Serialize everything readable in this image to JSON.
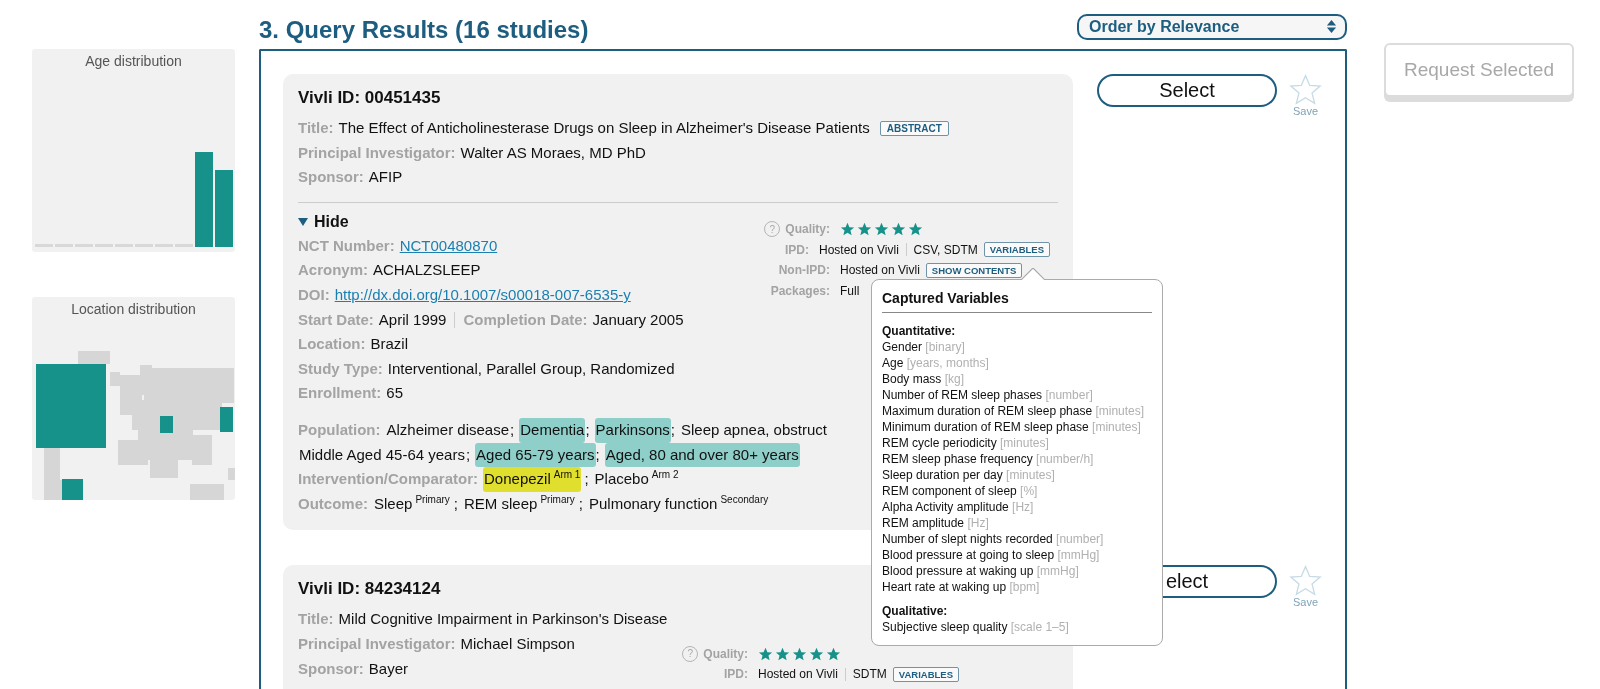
{
  "sidebar": {
    "panels": [
      {
        "kind": "age",
        "title": "Age distribution"
      },
      {
        "kind": "location",
        "title": "Location distribution"
      }
    ]
  },
  "header": {
    "title": "3. Query Results (16 studies)",
    "order": {
      "value": "Order by Relevance"
    }
  },
  "request_button": {
    "label": "Request Selected",
    "disabled": true
  },
  "cards": [
    {
      "heading": "Vivli ID: 00451435",
      "fields": [
        {
          "pairs": [
            {
              "label": "Title:",
              "value": "The Effect of Anticholinesterase Drugs on Sleep in Alzheimer's Disease Patients",
              "link": false
            }
          ],
          "button": "ABSTRACT"
        },
        {
          "pairs": [
            {
              "label": "Principal Investigator:",
              "value": "Walter AS Moraes, MD PhD",
              "link": false
            }
          ]
        },
        {
          "pairs": [
            {
              "label": "Sponsor:",
              "value": "AFIP",
              "link": false
            }
          ]
        }
      ],
      "expanded": true,
      "toggle_label": "Hide",
      "details": [
        {
          "pairs": [
            {
              "label": "NCT Number:",
              "value": "NCT00480870",
              "link": true
            }
          ]
        },
        {
          "pairs": [
            {
              "label": "Acronym:",
              "value": "ACHALZSLEEP",
              "link": false
            }
          ]
        },
        {
          "pairs": [
            {
              "label": "DOI:",
              "value": "http://dx.doi.org/10.1007/s00018-007-6535-y",
              "link": true
            }
          ]
        },
        {
          "pairs": [
            {
              "label": "Start Date:",
              "value": "April 1999",
              "link": false
            },
            {
              "label": "Completion Date:",
              "value": "January 2005",
              "link": false
            }
          ]
        },
        {
          "pairs": [
            {
              "label": "Location:",
              "value": "Brazil",
              "link": false
            }
          ]
        },
        {
          "pairs": [
            {
              "label": "Study Type:",
              "value": "Interventional, Parallel Group, Randomized",
              "link": false
            }
          ]
        },
        {
          "pairs": [
            {
              "label": "Enrollment:",
              "value": "65",
              "link": false
            }
          ]
        }
      ],
      "terms": [
        {
          "kind": "population",
          "label": "Population:",
          "lines": [
            [
              {
                "text": "Alzheimer disease",
                "sep": ";",
                "highlighted": false
              },
              {
                "text": "Dementia",
                "sep": ";",
                "highlighted": true
              },
              {
                "text": "Parkinsons",
                "sep": ";",
                "highlighted": true
              },
              {
                "text": "Sleep apnea, obstruct",
                "highlighted": false
              }
            ],
            [
              {
                "text": "Middle Aged 45-64 years",
                "sep": ";",
                "highlighted": false
              },
              {
                "text": "Aged 65-79 years",
                "sep": ";",
                "highlighted": true
              },
              {
                "text": "Aged, 80 and over 80+ years",
                "highlighted": true
              }
            ]
          ]
        },
        {
          "kind": "intervention",
          "label": "Intervention/Comparator:",
          "lines": [
            [
              {
                "text": "Donepezil",
                "sup": "Arm 1",
                "sep": ";",
                "highlighted": true
              },
              {
                "text": "Placebo",
                "sup": "Arm 2",
                "highlighted": false
              }
            ]
          ]
        },
        {
          "label": "Outcome:",
          "lines": [
            [
              {
                "text": "Sleep",
                "sup": "Primary",
                "sep": ";"
              },
              {
                "text": "REM sleep",
                "sup": "Primary",
                "sep": ";"
              },
              {
                "text": "Pulmonary function",
                "sup": "Secondary"
              }
            ]
          ]
        }
      ],
      "meta": {
        "help": "?",
        "quality_label": "Quality:",
        "stars": 5,
        "rows": [
          {
            "label": "IPD:",
            "value": "Hosted on Vivli",
            "extra": "CSV, SDTM",
            "button": "VARIABLES"
          },
          {
            "label": "Non-IPD:",
            "value": "Hosted on Vivli",
            "button": "SHOW CONTENTS"
          },
          {
            "label": "Packages:",
            "value": "Full"
          }
        ]
      },
      "select": {
        "label": "Select",
        "selected": false
      },
      "save": {
        "label": "Save",
        "saved": false
      }
    },
    {
      "heading": "Vivli ID: 84234124",
      "fields": [
        {
          "pairs": [
            {
              "label": "Title:",
              "value": "Mild Cognitive Impairment in Parkinson's Disease",
              "link": false
            }
          ]
        },
        {
          "pairs": [
            {
              "label": "Principal Investigator:",
              "value": "Michael Simpson",
              "link": false
            }
          ]
        },
        {
          "pairs": [
            {
              "label": "Sponsor:",
              "value": "Bayer",
              "link": false
            }
          ]
        }
      ],
      "expanded": false,
      "meta": {
        "help": "?",
        "quality_label": "Quality:",
        "stars": 5,
        "rows": [
          {
            "label": "IPD:",
            "value": "Hosted on Vivli",
            "extra": "SDTM",
            "button": "VARIABLES"
          }
        ]
      },
      "select": {
        "label": "elect",
        "selected": false
      },
      "save": {
        "label": "Save",
        "saved": false
      }
    }
  ],
  "popover": {
    "title": "Captured Variables",
    "groups": [
      {
        "heading": "Quantitative:",
        "items": [
          {
            "name": "Gender",
            "unit": "[binary]"
          },
          {
            "name": "Age",
            "unit": "[years, months]"
          },
          {
            "name": "Body mass",
            "unit": "[kg]"
          },
          {
            "name": "Number of REM sleep phases",
            "unit": "[number]"
          },
          {
            "name": "Maximum duration of REM sleep phase",
            "unit": "[minutes]"
          },
          {
            "name": "Minimum duration of REM sleep phase",
            "unit": "[minutes]"
          },
          {
            "name": "REM cycle periodicity",
            "unit": "[minutes]"
          },
          {
            "name": "REM sleep phase frequency",
            "unit": "[number/h]"
          },
          {
            "name": "Sleep duration per day",
            "unit": "[minutes]"
          },
          {
            "name": "REM component of sleep",
            "unit": "[%]"
          },
          {
            "name": "Alpha Activity amplitude",
            "unit": "[Hz]"
          },
          {
            "name": "REM amplitude",
            "unit": "[Hz]"
          },
          {
            "name": "Number of slept nights recorded",
            "unit": "[number]"
          },
          {
            "name": "Blood pressure at going to sleep",
            "unit": "[mmHg]"
          },
          {
            "name": "Blood pressure at waking up",
            "unit": "[mmHg]"
          },
          {
            "name": "Heart rate at waking up",
            "unit": "[bpm]"
          }
        ]
      },
      {
        "heading": "Qualitative:",
        "items": [
          {
            "name": "Subjective sleep quality",
            "unit": "[scale 1–5]"
          }
        ]
      }
    ]
  }
}
